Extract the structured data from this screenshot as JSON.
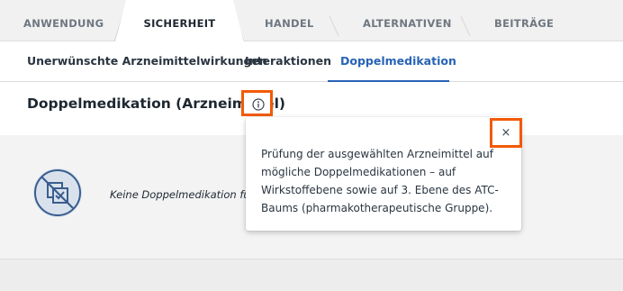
{
  "main_tabs": [
    {
      "label": "ANWENDUNG"
    },
    {
      "label": "SICHERHEIT"
    },
    {
      "label": "HANDEL"
    },
    {
      "label": "ALTERNATIVEN"
    },
    {
      "label": "BEITRÄGE"
    }
  ],
  "active_main_tab": "SICHERHEIT",
  "sub_tabs": [
    {
      "label": "Unerwünschte Arzneimittelwirkungen"
    },
    {
      "label": "Interaktionen"
    },
    {
      "label": "Doppelmedikation"
    }
  ],
  "active_sub_tab": "Doppelmedikation",
  "section": {
    "title": "Doppelmedikation (Arzneimittel)",
    "info_icon": "info-circle-icon",
    "empty_icon": "no-duplicate-medication-icon",
    "empty_text": "Keine Doppelmedikation für die ausgewählten Arzneimittel gefunden."
  },
  "popover": {
    "text": "Prüfung der ausgewählten Arzneimittel auf mögliche Doppelmedikationen – auf Wirkstoffebene sowie auf 3. Ebene des ATC-Baums (pharmakotherapeutische Gruppe).",
    "close_label": "×"
  },
  "colors": {
    "accent": "#2763b6",
    "highlight": "#f25a06",
    "icon_blue": "#3a5d8f",
    "icon_bg": "#d9e2ec"
  }
}
